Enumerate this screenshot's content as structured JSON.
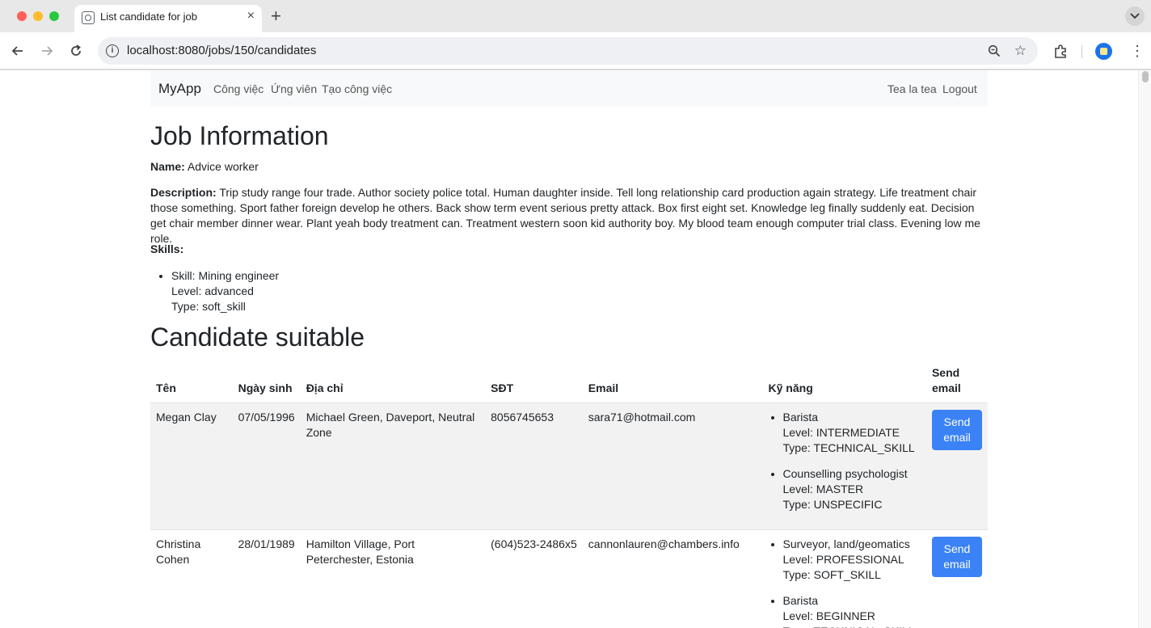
{
  "browser": {
    "tab_title": "List candidate for job",
    "url": "localhost:8080/jobs/150/candidates"
  },
  "navbar": {
    "brand": "MyApp",
    "links": [
      "Công việc",
      "Ứng viên",
      "Tạo công việc"
    ],
    "user": "Tea la tea",
    "logout": "Logout"
  },
  "job": {
    "heading": "Job Information",
    "name_label": "Name:",
    "name": "Advice worker",
    "description_label": "Description:",
    "description": "Trip study range four trade. Author society police total. Human daughter inside. Tell long relationship card production again strategy. Life treatment chair those something. Sport father foreign develop he others. Back show term event serious pretty attack. Box first eight set. Knowledge leg finally suddenly eat. Decision get chair member dinner wear. Plant yeah body treatment can. Treatment western soon kid authority boy. My blood team enough computer trial class. Evening low me role.",
    "skills_label": "Skills:",
    "skills": [
      {
        "skill": "Skill: Mining engineer",
        "level": "Level: advanced",
        "type": "Type: soft_skill"
      }
    ]
  },
  "candidates": {
    "heading": "Candidate suitable",
    "columns": [
      "Tên",
      "Ngày sinh",
      "Địa chỉ",
      "SĐT",
      "Email",
      "Kỹ năng",
      "Send email"
    ],
    "send_label": "Send email",
    "rows": [
      {
        "name": "Megan Clay",
        "dob": "07/05/1996",
        "address": "Michael Green, Daveport, Neutral Zone",
        "phone": "8056745653",
        "email": "sara71@hotmail.com",
        "skills": [
          {
            "name": "Barista",
            "level": "Level: INTERMEDIATE",
            "type": "Type: TECHNICAL_SKILL"
          },
          {
            "name": "Counselling psychologist",
            "level": "Level: MASTER",
            "type": "Type: UNSPECIFIC"
          }
        ]
      },
      {
        "name": "Christina Cohen",
        "dob": "28/01/1989",
        "address": "Hamilton Village, Port Peterchester, Estonia",
        "phone": "(604)523-2486x5",
        "email": "cannonlauren@chambers.info",
        "skills": [
          {
            "name": "Surveyor, land/geomatics",
            "level": "Level: PROFESSIONAL",
            "type": "Type: SOFT_SKILL"
          },
          {
            "name": "Barista",
            "level": "Level: BEGINNER",
            "type": "Type: TECHNICAL_SKILL"
          }
        ]
      }
    ]
  }
}
